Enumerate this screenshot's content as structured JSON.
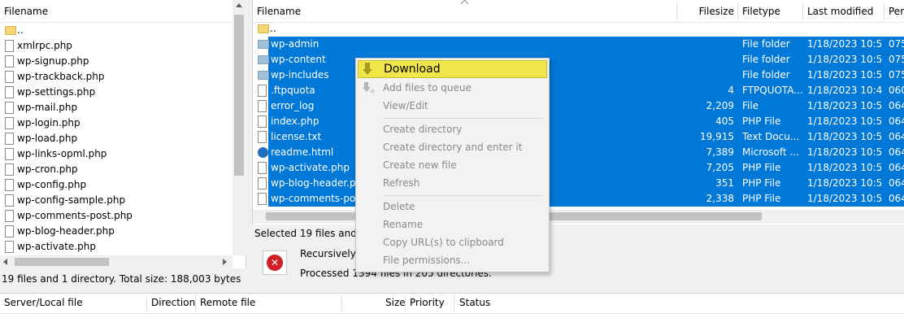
{
  "local": {
    "header": "Filename",
    "files": [
      "..",
      "xmlrpc.php",
      "wp-signup.php",
      "wp-trackback.php",
      "wp-settings.php",
      "wp-mail.php",
      "wp-login.php",
      "wp-load.php",
      "wp-links-opml.php",
      "wp-cron.php",
      "wp-config.php",
      "wp-config-sample.php",
      "wp-comments-post.php",
      "wp-blog-header.php",
      "wp-activate.php"
    ],
    "status": "19 files and 1 directory. Total size: 188,003 bytes"
  },
  "remote": {
    "headers": {
      "filename": "Filename",
      "filesize": "Filesize",
      "filetype": "Filetype",
      "modified": "Last modified",
      "perm": "Per"
    },
    "rows": [
      {
        "name": "..",
        "size": "",
        "type": "",
        "date": "",
        "perm": ""
      },
      {
        "name": "wp-admin",
        "size": "",
        "type": "File folder",
        "date": "1/18/2023 10:5...",
        "perm": "075"
      },
      {
        "name": "wp-content",
        "size": "",
        "type": "File folder",
        "date": "1/18/2023 10:5...",
        "perm": "075"
      },
      {
        "name": "wp-includes",
        "size": "",
        "type": "File folder",
        "date": "1/18/2023 10:5...",
        "perm": "075"
      },
      {
        "name": ".ftpquota",
        "size": "4",
        "type": "FTPQUOTA...",
        "date": "1/18/2023 10:4...",
        "perm": "060"
      },
      {
        "name": "error_log",
        "size": "2,209",
        "type": "File",
        "date": "1/18/2023 10:5...",
        "perm": "064"
      },
      {
        "name": "index.php",
        "size": "405",
        "type": "PHP File",
        "date": "1/18/2023 10:5...",
        "perm": "064"
      },
      {
        "name": "license.txt",
        "size": "19,915",
        "type": "Text Docu...",
        "date": "1/18/2023 10:5...",
        "perm": "064"
      },
      {
        "name": "readme.html",
        "size": "7,389",
        "type": "Microsoft ...",
        "date": "1/18/2023 10:5...",
        "perm": "064"
      },
      {
        "name": "wp-activate.php",
        "size": "7,205",
        "type": "PHP File",
        "date": "1/18/2023 10:5...",
        "perm": "064"
      },
      {
        "name": "wp-blog-header.php",
        "size": "351",
        "type": "PHP File",
        "date": "1/18/2023 10:5...",
        "perm": "064"
      },
      {
        "name": "wp-comments-post.php",
        "size": "2,338",
        "type": "PHP File",
        "date": "1/18/2023 10:5...",
        "perm": "064"
      }
    ],
    "status": "Selected 19 files and 3 d"
  },
  "context_menu": {
    "items": [
      "Download",
      "Add files to queue",
      "View/Edit",
      "Create directory",
      "Create directory and enter it",
      "Create new file",
      "Refresh",
      "Delete",
      "Rename",
      "Copy URL(s) to clipboard",
      "File permissions..."
    ]
  },
  "progress": {
    "line1": "Recursively a",
    "line2": "Processed 1394 files in 205 directories."
  },
  "queue": {
    "headers": [
      "Server/Local file",
      "Direction",
      "Remote file",
      "Size",
      "Priority",
      "Status"
    ]
  },
  "colors": {
    "selection": "#0078d7",
    "highlight": "#f0e64a",
    "cancel": "#d0202a"
  }
}
